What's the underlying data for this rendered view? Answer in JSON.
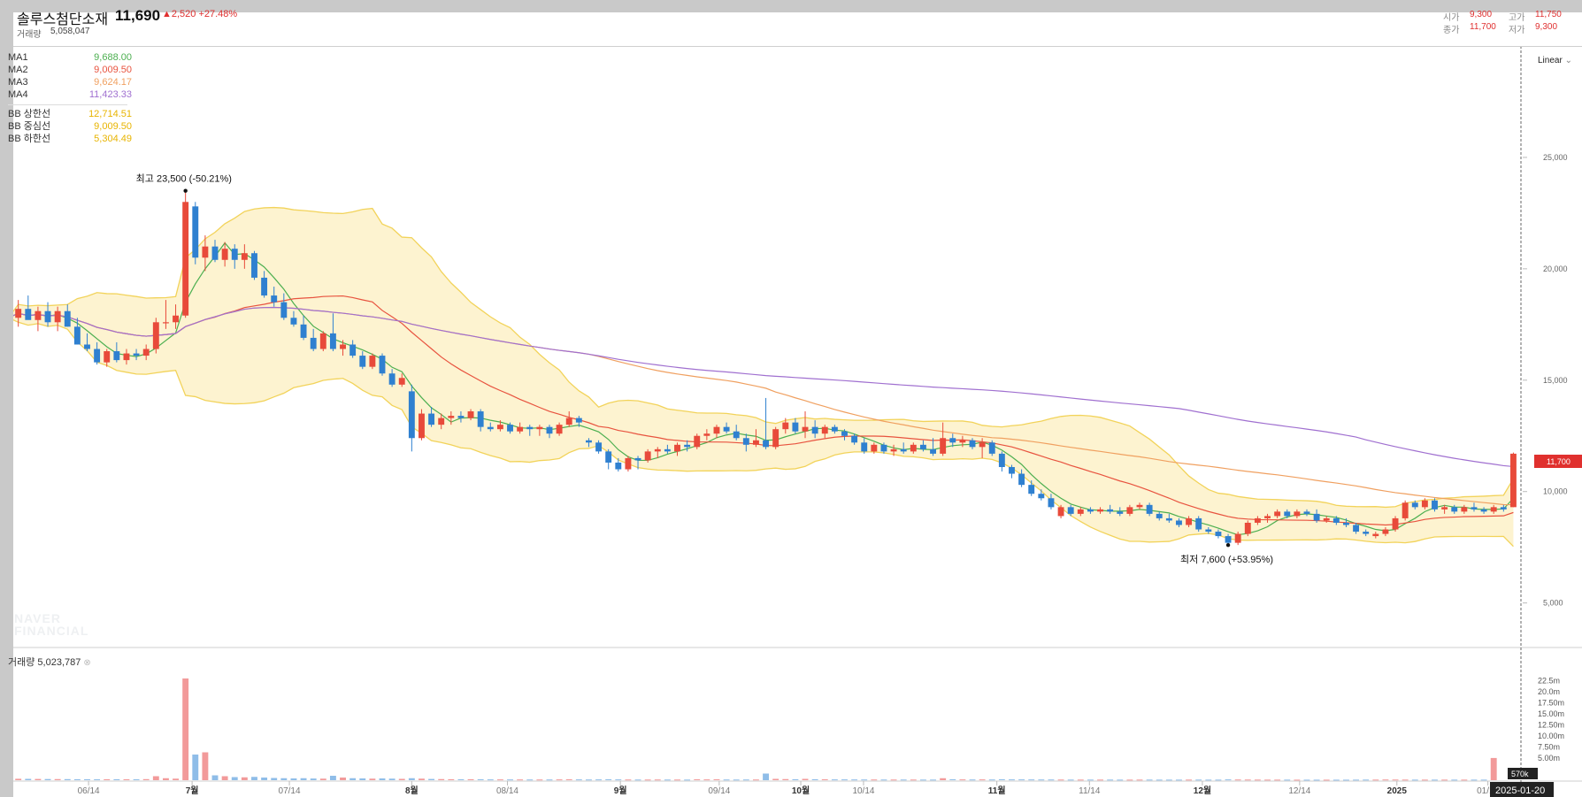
{
  "header": {
    "name": "솔루스첨단소재",
    "price": "11,690",
    "change": "▲2,520 +27.48%",
    "volume_label": "거래량",
    "volume_value": "5,058,047",
    "open_label": "시가",
    "open_value": "9,300",
    "high_label": "고가",
    "high_value": "11,750",
    "close_label": "종가",
    "close_value": "11,700",
    "low_label": "저가",
    "low_value": "9,300"
  },
  "legend": {
    "ma": [
      {
        "name": "MA1",
        "value": "9,688.00",
        "color": "#4caf50"
      },
      {
        "name": "MA2",
        "value": "9,009.50",
        "color": "#e8533f"
      },
      {
        "name": "MA3",
        "value": "9,624.17",
        "color": "#f0a060"
      },
      {
        "name": "MA4",
        "value": "11,423.33",
        "color": "#a070d0"
      }
    ],
    "bb": [
      {
        "name": "BB 상한선",
        "value": "12,714.51",
        "color": "#e8b400"
      },
      {
        "name": "BB 중심선",
        "value": "9,009.50",
        "color": "#e8b400"
      },
      {
        "name": "BB 하한선",
        "value": "5,304.49",
        "color": "#e8b400"
      }
    ]
  },
  "scale_label": "Linear",
  "watermark": {
    "line1": "NAVER",
    "line2": "FINANCIAL"
  },
  "volume_panel_title": "거래량 5,023,787",
  "current_price_tag": "11,700",
  "current_volume_tag": "570k",
  "crosshair_date": "2025-01-20",
  "annotations": {
    "high": "최고 23,500 (-50.21%)",
    "low": "최저 7,600 (+53.95%)"
  },
  "colors": {
    "up": "#e84a3a",
    "down": "#2f80d0",
    "bb_fill": "#fdf3d0",
    "bb_line": "#f2d35a"
  },
  "chart_data": {
    "type": "candlestick",
    "price_axis": {
      "ticks": [
        5000,
        10000,
        15000,
        20000,
        25000
      ],
      "tick_labels": [
        "5,000",
        "10,000",
        "15,000",
        "20,000",
        "25,000"
      ],
      "ylim": [
        3000,
        30000
      ]
    },
    "volume_axis": {
      "tick_labels": [
        "5.00m",
        "7.50m",
        "10.00m",
        "12.50m",
        "15.00m",
        "17.50m",
        "20.0m",
        "22.5m"
      ],
      "ticks": [
        5,
        7.5,
        10,
        12.5,
        15,
        17.5,
        20,
        22.5
      ]
    },
    "x_tick_labels": [
      "06/14",
      "7월",
      "07/14",
      "8월",
      "08/14",
      "9월",
      "09/14",
      "10월",
      "10/14",
      "11월",
      "11/14",
      "12월",
      "12/14",
      "2025",
      "01/14"
    ],
    "candles": [
      [
        17200,
        18000,
        16900,
        17800
      ],
      [
        17800,
        18600,
        17400,
        18200
      ],
      [
        18200,
        18800,
        17800,
        17700
      ],
      [
        17700,
        18300,
        17200,
        18100
      ],
      [
        18100,
        18500,
        17400,
        17600
      ],
      [
        17600,
        18300,
        17200,
        18100
      ],
      [
        18100,
        18400,
        17400,
        17400
      ],
      [
        17400,
        17800,
        16600,
        16600
      ],
      [
        16600,
        17100,
        16300,
        16400
      ],
      [
        16400,
        16700,
        15700,
        15800
      ],
      [
        15800,
        16400,
        15600,
        16300
      ],
      [
        16300,
        16700,
        15800,
        15900
      ],
      [
        15900,
        16400,
        15700,
        16200
      ],
      [
        16200,
        16400,
        15900,
        16100
      ],
      [
        16100,
        16600,
        15900,
        16400
      ],
      [
        16400,
        17800,
        16200,
        17600
      ],
      [
        17600,
        18600,
        17300,
        17600
      ],
      [
        17600,
        18400,
        17300,
        17900
      ],
      [
        17900,
        23500,
        17800,
        23000
      ],
      [
        22800,
        23000,
        20200,
        20500
      ],
      [
        20500,
        21500,
        19900,
        21000
      ],
      [
        21000,
        21300,
        20300,
        20400
      ],
      [
        20400,
        21200,
        20100,
        20900
      ],
      [
        20900,
        21100,
        20000,
        20400
      ],
      [
        20400,
        21100,
        20000,
        20700
      ],
      [
        20700,
        20800,
        19500,
        19600
      ],
      [
        19600,
        19900,
        18700,
        18800
      ],
      [
        18800,
        19200,
        18300,
        18500
      ],
      [
        18500,
        18900,
        17700,
        17800
      ],
      [
        17800,
        18100,
        17400,
        17500
      ],
      [
        17500,
        17900,
        16800,
        16900
      ],
      [
        16900,
        17300,
        16300,
        16400
      ],
      [
        16400,
        17200,
        16300,
        17100
      ],
      [
        17100,
        18000,
        16300,
        16400
      ],
      [
        16400,
        16800,
        16100,
        16600
      ],
      [
        16600,
        16800,
        16000,
        16100
      ],
      [
        16100,
        16300,
        15500,
        15600
      ],
      [
        15600,
        16200,
        15500,
        16100
      ],
      [
        16100,
        16200,
        15200,
        15300
      ],
      [
        15300,
        15500,
        14700,
        14800
      ],
      [
        14800,
        15300,
        14700,
        15100
      ],
      [
        14500,
        14800,
        11800,
        12400
      ],
      [
        12400,
        13700,
        12300,
        13500
      ],
      [
        13500,
        13800,
        12900,
        13000
      ],
      [
        13000,
        13500,
        12800,
        13300
      ],
      [
        13300,
        13600,
        13000,
        13400
      ],
      [
        13400,
        13600,
        13100,
        13300
      ],
      [
        13300,
        13700,
        13200,
        13600
      ],
      [
        13600,
        13700,
        12700,
        12900
      ],
      [
        12900,
        13100,
        12700,
        12800
      ],
      [
        12800,
        13200,
        12700,
        13000
      ],
      [
        13000,
        13100,
        12600,
        12700
      ],
      [
        12700,
        13100,
        12600,
        12900
      ],
      [
        12900,
        13000,
        12500,
        12800
      ],
      [
        12800,
        13000,
        12500,
        12900
      ],
      [
        12900,
        13000,
        12400,
        12600
      ],
      [
        12600,
        13100,
        12500,
        13000
      ],
      [
        13000,
        13600,
        12900,
        13300
      ],
      [
        13300,
        13400,
        12900,
        13100
      ],
      [
        12300,
        12400,
        12000,
        12200
      ],
      [
        12200,
        12300,
        11700,
        11800
      ],
      [
        11800,
        11900,
        11000,
        11300
      ],
      [
        11300,
        11500,
        10900,
        11000
      ],
      [
        11000,
        11600,
        10900,
        11500
      ],
      [
        11500,
        11600,
        11000,
        11400
      ],
      [
        11400,
        11900,
        11300,
        11800
      ],
      [
        11800,
        12000,
        11500,
        11900
      ],
      [
        11900,
        12100,
        11700,
        11800
      ],
      [
        11800,
        12200,
        11600,
        12100
      ],
      [
        12100,
        12300,
        11800,
        12000
      ],
      [
        12000,
        12600,
        11900,
        12500
      ],
      [
        12500,
        12800,
        12300,
        12600
      ],
      [
        12600,
        13000,
        12400,
        12900
      ],
      [
        12900,
        13100,
        12600,
        12700
      ],
      [
        12700,
        13000,
        12300,
        12400
      ],
      [
        12400,
        12600,
        11800,
        12100
      ],
      [
        12100,
        12800,
        12000,
        12300
      ],
      [
        12300,
        14200,
        11900,
        12000
      ],
      [
        12000,
        12900,
        11900,
        12800
      ],
      [
        12800,
        13300,
        12600,
        13100
      ],
      [
        13100,
        13300,
        12600,
        12700
      ],
      [
        12700,
        13600,
        12400,
        12900
      ],
      [
        12900,
        13200,
        12400,
        12600
      ],
      [
        12600,
        13000,
        12400,
        12900
      ],
      [
        12900,
        13000,
        12600,
        12700
      ],
      [
        12700,
        12800,
        12300,
        12500
      ],
      [
        12500,
        12600,
        12100,
        12200
      ],
      [
        12200,
        12400,
        11700,
        11800
      ],
      [
        11800,
        12200,
        11700,
        12100
      ],
      [
        12100,
        12200,
        11700,
        11800
      ],
      [
        11800,
        12100,
        11600,
        11900
      ],
      [
        11900,
        12200,
        11700,
        11800
      ],
      [
        11800,
        12200,
        11700,
        12100
      ],
      [
        12100,
        12300,
        11800,
        11900
      ],
      [
        11900,
        12400,
        11600,
        11700
      ],
      [
        11700,
        13100,
        11600,
        12400
      ],
      [
        12400,
        12600,
        12000,
        12200
      ],
      [
        12200,
        12500,
        12000,
        12300
      ],
      [
        12300,
        12400,
        11900,
        12000
      ],
      [
        12000,
        12400,
        11500,
        12200
      ],
      [
        12200,
        12300,
        11600,
        11700
      ],
      [
        11700,
        11800,
        10900,
        11100
      ],
      [
        11100,
        11200,
        10600,
        10800
      ],
      [
        10800,
        11000,
        10200,
        10300
      ],
      [
        10300,
        10500,
        9800,
        9900
      ],
      [
        9900,
        10100,
        9600,
        9700
      ],
      [
        9700,
        9900,
        9200,
        9300
      ],
      [
        8900,
        9400,
        8800,
        9300
      ],
      [
        9300,
        9400,
        8900,
        9000
      ],
      [
        9000,
        9300,
        8900,
        9200
      ],
      [
        9200,
        9300,
        9000,
        9100
      ],
      [
        9100,
        9300,
        9000,
        9200
      ],
      [
        9200,
        9400,
        9000,
        9100
      ],
      [
        9100,
        9300,
        8900,
        9000
      ],
      [
        9000,
        9400,
        8900,
        9300
      ],
      [
        9300,
        9500,
        9200,
        9400
      ],
      [
        9400,
        9500,
        8900,
        9000
      ],
      [
        9000,
        9100,
        8700,
        8800
      ],
      [
        8800,
        9000,
        8600,
        8700
      ],
      [
        8700,
        8800,
        8400,
        8500
      ],
      [
        8500,
        8900,
        8400,
        8800
      ],
      [
        8800,
        8900,
        8200,
        8300
      ],
      [
        8300,
        8400,
        8100,
        8200
      ],
      [
        8200,
        8300,
        7900,
        8000
      ],
      [
        8000,
        8100,
        7600,
        7700
      ],
      [
        7700,
        8200,
        7600,
        8100
      ],
      [
        8100,
        8700,
        8000,
        8600
      ],
      [
        8600,
        8900,
        8500,
        8800
      ],
      [
        8800,
        9000,
        8600,
        8900
      ],
      [
        8900,
        9200,
        8800,
        9100
      ],
      [
        9100,
        9200,
        8800,
        8900
      ],
      [
        8900,
        9200,
        8800,
        9100
      ],
      [
        9100,
        9200,
        8900,
        9000
      ],
      [
        9000,
        9200,
        8600,
        8700
      ],
      [
        8700,
        8900,
        8600,
        8800
      ],
      [
        8800,
        8900,
        8500,
        8600
      ],
      [
        8600,
        8800,
        8400,
        8500
      ],
      [
        8500,
        8600,
        8100,
        8200
      ],
      [
        8200,
        8300,
        8000,
        8100
      ],
      [
        8000,
        8200,
        7900,
        8100
      ],
      [
        8100,
        8400,
        8000,
        8300
      ],
      [
        8300,
        8900,
        8200,
        8800
      ],
      [
        8800,
        9600,
        8700,
        9500
      ],
      [
        9500,
        9600,
        9200,
        9300
      ],
      [
        9300,
        9700,
        9200,
        9600
      ],
      [
        9600,
        9700,
        9100,
        9200
      ],
      [
        9200,
        9400,
        9000,
        9300
      ],
      [
        9300,
        9400,
        9000,
        9100
      ],
      [
        9100,
        9400,
        9000,
        9300
      ],
      [
        9300,
        9500,
        9100,
        9200
      ],
      [
        9200,
        9300,
        9000,
        9100
      ],
      [
        9100,
        9400,
        9000,
        9300
      ],
      [
        9300,
        9400,
        9100,
        9200
      ],
      [
        9300,
        11750,
        9300,
        11700
      ]
    ],
    "volumes": [
      0.35,
      0.32,
      0.3,
      0.28,
      0.26,
      0.25,
      0.24,
      0.22,
      0.22,
      0.2,
      0.22,
      0.22,
      0.21,
      0.2,
      0.24,
      0.9,
      0.45,
      0.35,
      23.0,
      5.8,
      6.3,
      1.1,
      0.9,
      0.7,
      0.65,
      0.75,
      0.6,
      0.5,
      0.45,
      0.4,
      0.45,
      0.38,
      0.35,
      1.0,
      0.6,
      0.45,
      0.4,
      0.35,
      0.4,
      0.35,
      0.3,
      0.45,
      0.35,
      0.28,
      0.25,
      0.22,
      0.2,
      0.22,
      0.2,
      0.18,
      0.18,
      0.17,
      0.17,
      0.16,
      0.16,
      0.16,
      0.18,
      0.2,
      0.18,
      0.16,
      0.18,
      0.2,
      0.18,
      0.16,
      0.15,
      0.15,
      0.16,
      0.15,
      0.15,
      0.14,
      0.2,
      0.18,
      0.2,
      0.16,
      0.15,
      0.16,
      0.16,
      1.5,
      0.3,
      0.25,
      0.22,
      0.3,
      0.22,
      0.2,
      0.18,
      0.18,
      0.17,
      0.16,
      0.16,
      0.15,
      0.15,
      0.15,
      0.15,
      0.14,
      0.14,
      0.45,
      0.2,
      0.18,
      0.16,
      0.18,
      0.16,
      0.2,
      0.18,
      0.18,
      0.17,
      0.16,
      0.16,
      0.15,
      0.14,
      0.14,
      0.14,
      0.14,
      0.14,
      0.13,
      0.13,
      0.14,
      0.14,
      0.13,
      0.13,
      0.13,
      0.14,
      0.14,
      0.13,
      0.13,
      0.18,
      0.16,
      0.15,
      0.14,
      0.13,
      0.13,
      0.13,
      0.12,
      0.12,
      0.12,
      0.12,
      0.12,
      0.12,
      0.13,
      0.14,
      0.14,
      0.16,
      0.15,
      0.14,
      0.13,
      0.13,
      0.13,
      0.13,
      0.13,
      0.13,
      0.13,
      0.13,
      5.02
    ]
  }
}
